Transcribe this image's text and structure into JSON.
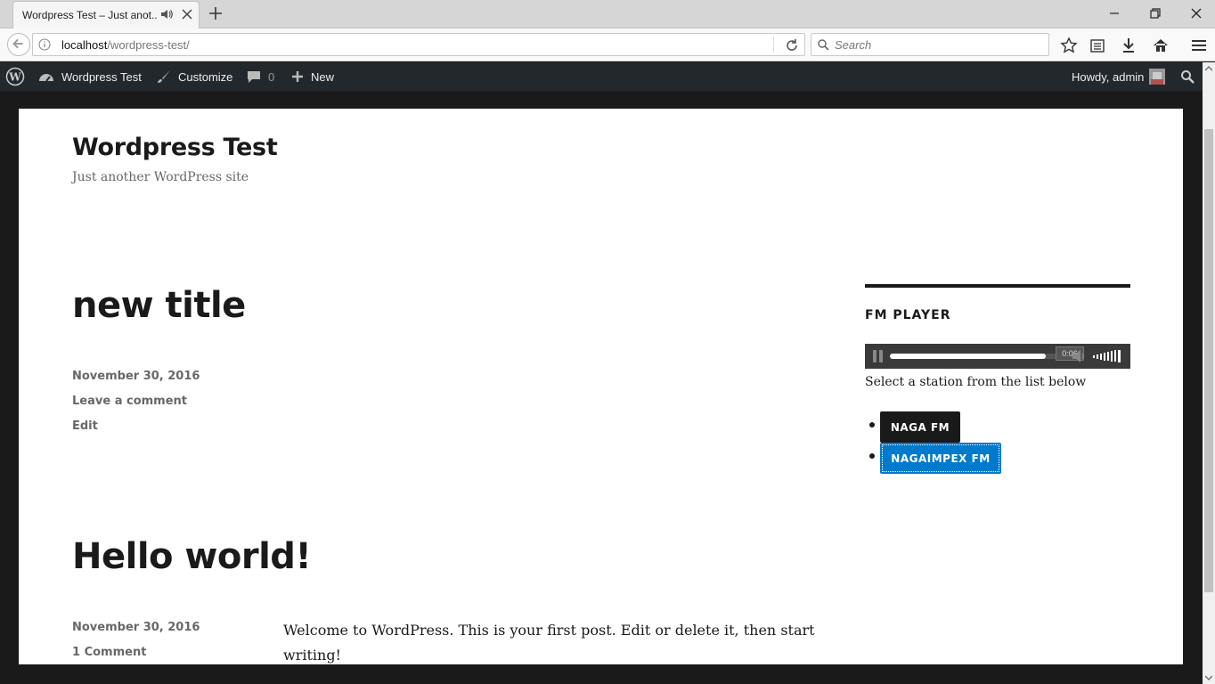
{
  "browser": {
    "tab_title": "Wordpress Test – Just anot...",
    "url_host": "localhost",
    "url_path": "/wordpress-test/",
    "search_placeholder": "Search"
  },
  "adminbar": {
    "site_name": "Wordpress Test",
    "customize": "Customize",
    "comments_count": "0",
    "new_label": "New",
    "howdy": "Howdy, admin"
  },
  "site": {
    "title": "Wordpress Test",
    "description": "Just another WordPress site"
  },
  "posts": [
    {
      "title": "new title",
      "date": "November 30, 2016",
      "comment_link": "Leave a comment",
      "edit_link": "Edit"
    },
    {
      "title": "Hello world!",
      "date": "November 30, 2016",
      "comment_link": "1 Comment",
      "content": "Welcome to WordPress. This is your first post. Edit or delete it, then start writing!"
    }
  ],
  "widget": {
    "title": "FM PLAYER",
    "player_time": "0:06",
    "player_progress": 0.93,
    "instruction": "Select a station from the list below",
    "stations": [
      {
        "label": "NAGA FM",
        "active": false
      },
      {
        "label": "NAGAIMPEX FM",
        "active": true
      }
    ]
  },
  "colors": {
    "adminbar_bg": "#23282d",
    "active_station": "#007acc",
    "page_bg": "#ffffff",
    "frame_bg": "#1a1a1a"
  }
}
